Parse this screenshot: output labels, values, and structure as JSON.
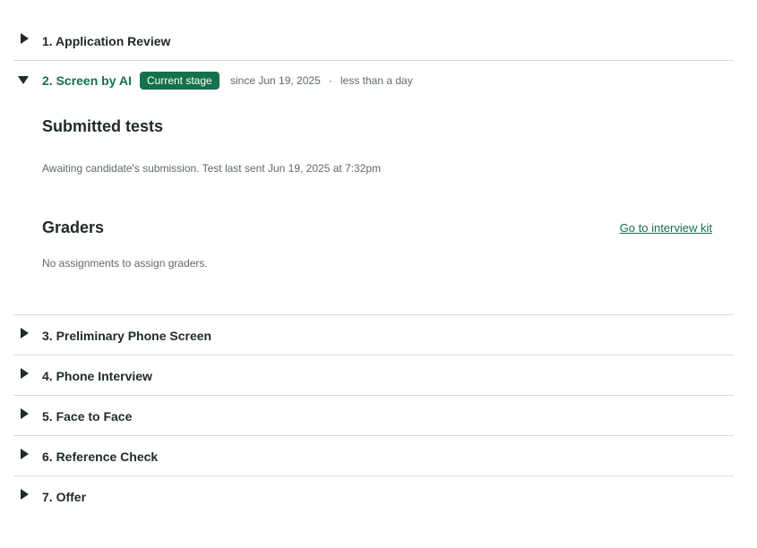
{
  "colors": {
    "accent": "#15714b",
    "text": "#1f2a27",
    "muted": "#5e6b67",
    "divider": "#d9dcdb"
  },
  "stages": [
    {
      "title": "1. Application Review",
      "state": "collapsed",
      "icon": "caret-right-icon"
    },
    {
      "title": "2. Screen by AI",
      "state": "expanded",
      "icon": "caret-down-icon",
      "badge": "Current stage",
      "since": "since Jun 19, 2025",
      "separator": "·",
      "duration": "less than a day"
    },
    {
      "title": "3. Preliminary Phone Screen",
      "state": "collapsed",
      "icon": "caret-right-icon"
    },
    {
      "title": "4. Phone Interview",
      "state": "collapsed",
      "icon": "caret-right-icon"
    },
    {
      "title": "5. Face to Face",
      "state": "collapsed",
      "icon": "caret-right-icon"
    },
    {
      "title": "6. Reference Check",
      "state": "collapsed",
      "icon": "caret-right-icon"
    },
    {
      "title": "7. Offer",
      "state": "collapsed",
      "icon": "caret-right-icon"
    }
  ],
  "submitted_tests": {
    "heading": "Submitted tests",
    "status": "Awaiting candidate's submission. Test last sent Jun 19, 2025 at 7:32pm"
  },
  "graders": {
    "heading": "Graders",
    "link": "Go to interview kit",
    "empty": "No assignments to assign graders."
  }
}
